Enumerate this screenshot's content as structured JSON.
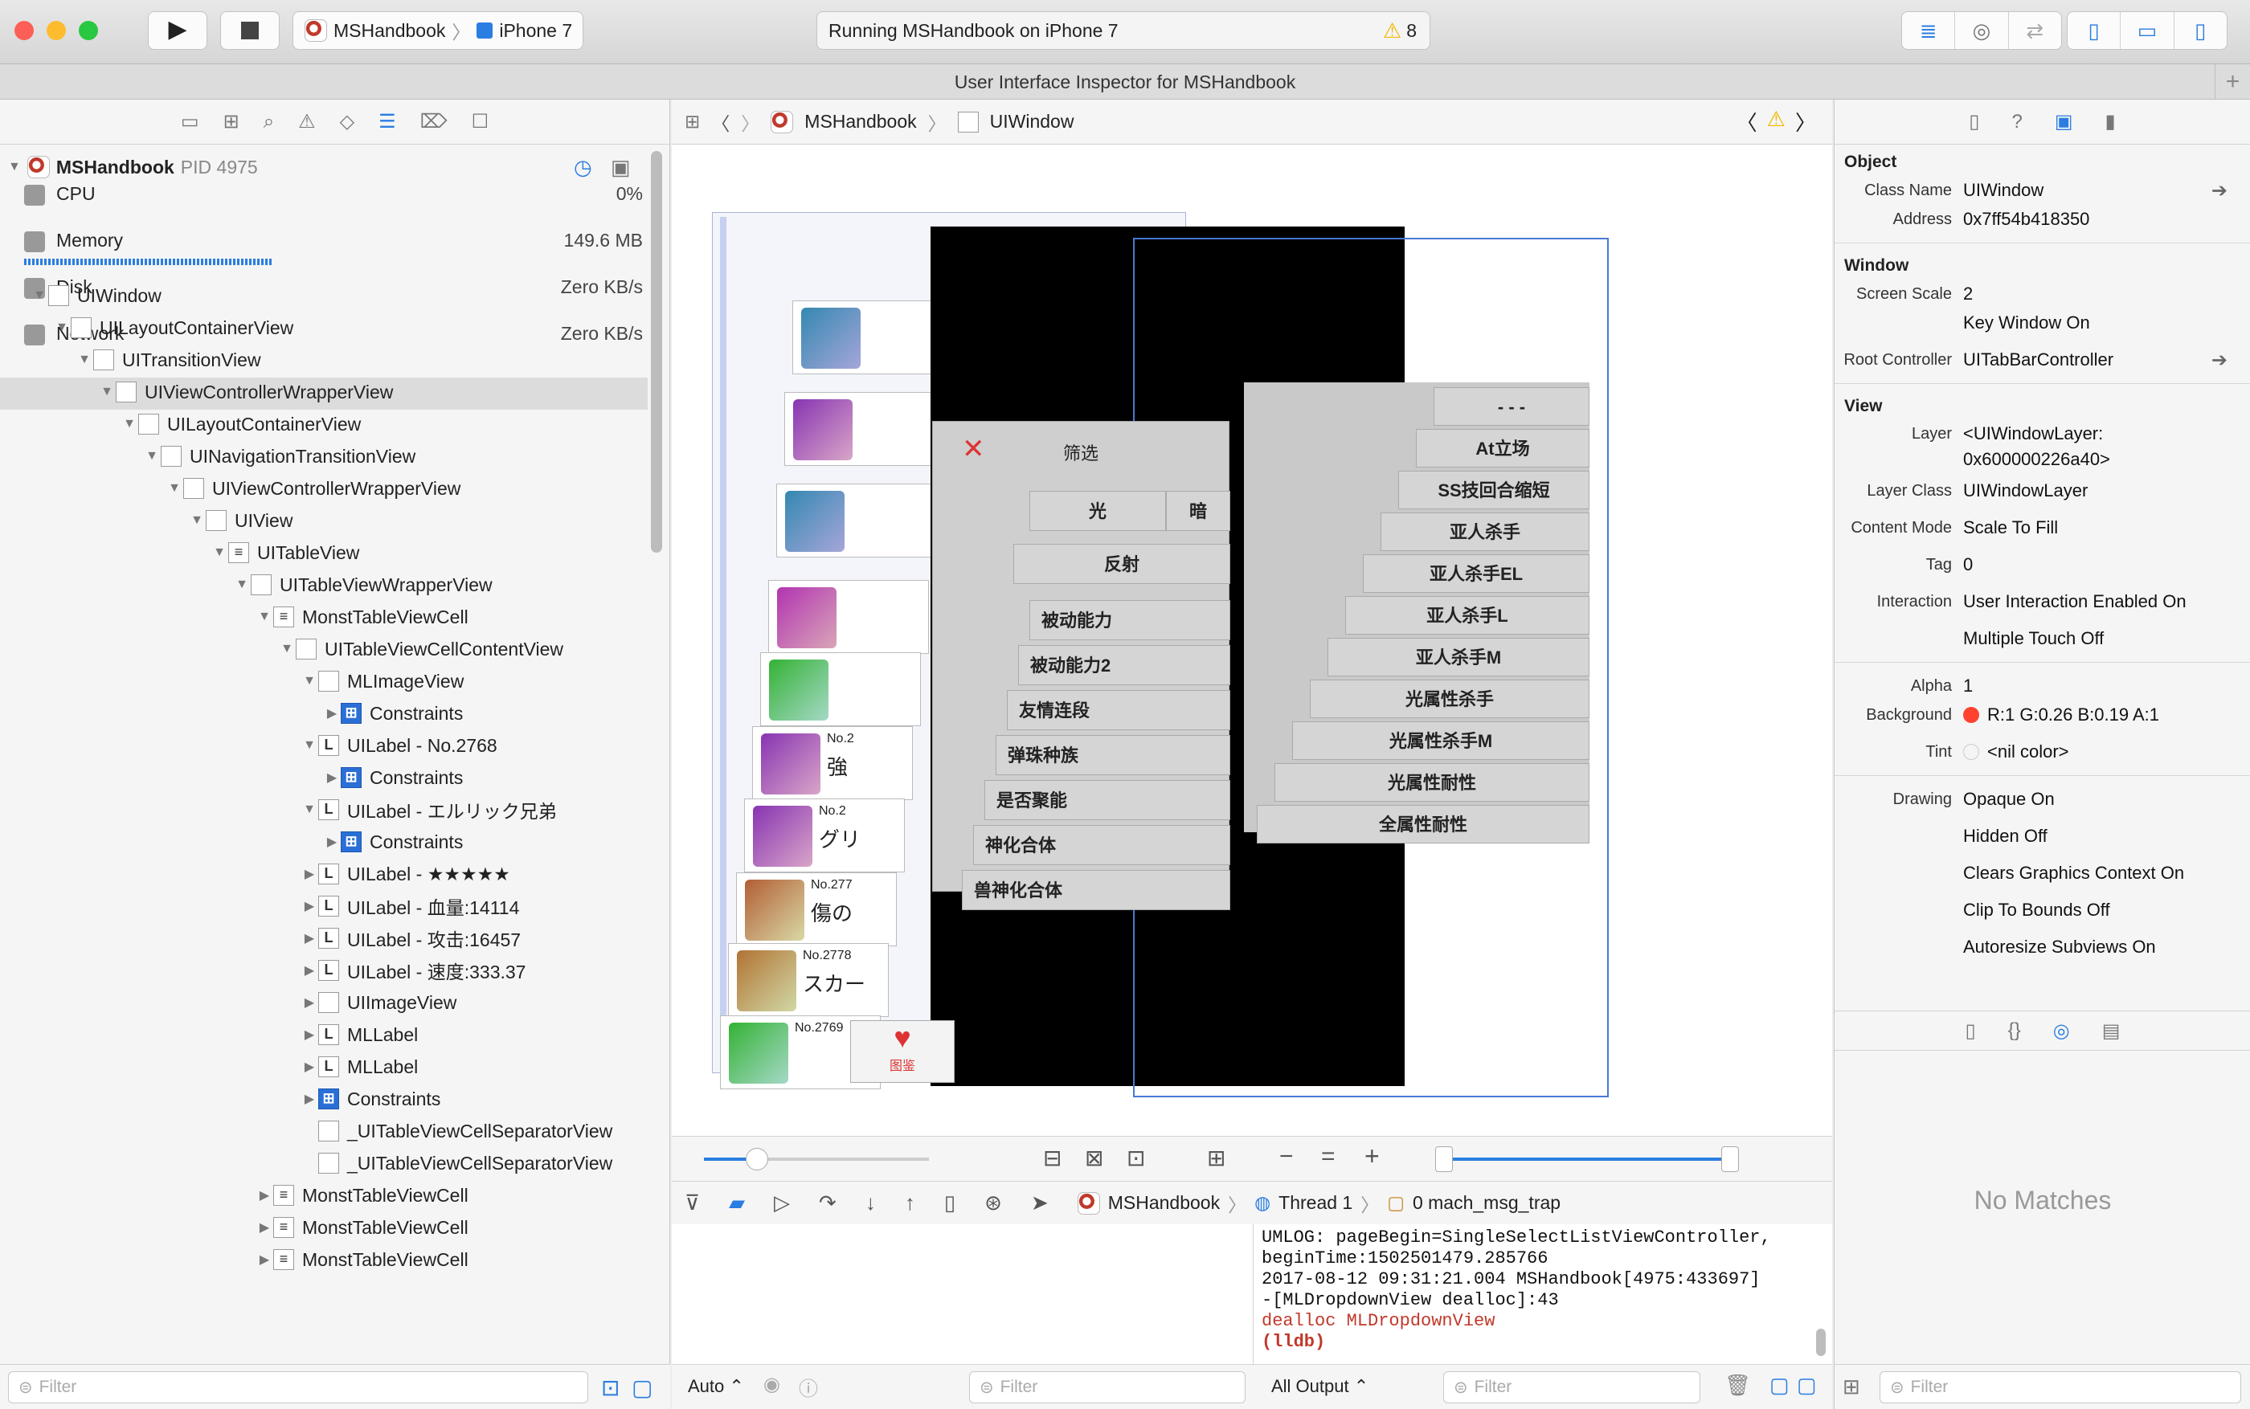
{
  "toolbar": {
    "scheme_app": "MSHandbook",
    "scheme_device": "iPhone 7",
    "status": "Running MSHandbook on iPhone 7",
    "warning_count": "8"
  },
  "tabbar": {
    "title": "User Interface Inspector for MSHandbook"
  },
  "navigator": {
    "process": {
      "name": "MSHandbook",
      "pid": "PID 4975"
    },
    "gauges": [
      {
        "label": "CPU",
        "value": "0%"
      },
      {
        "label": "Memory",
        "value": "149.6 MB"
      },
      {
        "label": "Disk",
        "value": "Zero KB/s"
      },
      {
        "label": "Network",
        "value": "Zero KB/s"
      }
    ],
    "tree": [
      {
        "label": "UIWindow",
        "depth": 0,
        "tri": "▼",
        "icon": "w",
        "selected": true
      },
      {
        "label": "UILayoutContainerView",
        "depth": 1,
        "tri": "▼",
        "icon": "v"
      },
      {
        "label": "UITransitionView",
        "depth": 2,
        "tri": "▼",
        "icon": "v"
      },
      {
        "label": "UIViewControllerWrapperView",
        "depth": 3,
        "tri": "▼",
        "icon": "v"
      },
      {
        "label": "UILayoutContainerView",
        "depth": 4,
        "tri": "▼",
        "icon": "v"
      },
      {
        "label": "UINavigationTransitionView",
        "depth": 5,
        "tri": "▼",
        "icon": "v"
      },
      {
        "label": "UIViewControllerWrapperView",
        "depth": 6,
        "tri": "▼",
        "icon": "v"
      },
      {
        "label": "UIView",
        "depth": 7,
        "tri": "▼",
        "icon": "v"
      },
      {
        "label": "UITableView",
        "depth": 8,
        "tri": "▼",
        "icon": "t"
      },
      {
        "label": "UITableViewWrapperView",
        "depth": 9,
        "tri": "▼",
        "icon": "v"
      },
      {
        "label": "MonstTableViewCell",
        "depth": 10,
        "tri": "▼",
        "icon": "t"
      },
      {
        "label": "UITableViewCellContentView",
        "depth": 11,
        "tri": "▼",
        "icon": "v"
      },
      {
        "label": "MLImageView",
        "depth": 12,
        "tri": "▼",
        "icon": "i"
      },
      {
        "label": "Constraints",
        "depth": 13,
        "tri": "▶",
        "icon": "c"
      },
      {
        "label": "UILabel - No.2768",
        "depth": 12,
        "tri": "▼",
        "icon": "L"
      },
      {
        "label": "Constraints",
        "depth": 13,
        "tri": "▶",
        "icon": "c"
      },
      {
        "label": "UILabel - エルリック兄弟",
        "depth": 12,
        "tri": "▼",
        "icon": "L"
      },
      {
        "label": "Constraints",
        "depth": 13,
        "tri": "▶",
        "icon": "c"
      },
      {
        "label": "UILabel - ★★★★★",
        "depth": 12,
        "tri": "▶",
        "icon": "L"
      },
      {
        "label": "UILabel - 血量:14114",
        "depth": 12,
        "tri": "▶",
        "icon": "L"
      },
      {
        "label": "UILabel - 攻击:16457",
        "depth": 12,
        "tri": "▶",
        "icon": "L"
      },
      {
        "label": "UILabel - 速度:333.37",
        "depth": 12,
        "tri": "▶",
        "icon": "L"
      },
      {
        "label": "UIImageView",
        "depth": 12,
        "tri": "▶",
        "icon": "i"
      },
      {
        "label": "MLLabel",
        "depth": 12,
        "tri": "▶",
        "icon": "L"
      },
      {
        "label": "MLLabel",
        "depth": 12,
        "tri": "▶",
        "icon": "L"
      },
      {
        "label": "Constraints",
        "depth": 12,
        "tri": "▶",
        "icon": "c"
      },
      {
        "label": "_UITableViewCellSeparatorView",
        "depth": 12,
        "tri": "",
        "icon": "v"
      },
      {
        "label": "_UITableViewCellSeparatorView",
        "depth": 12,
        "tri": "",
        "icon": "v"
      },
      {
        "label": "MonstTableViewCell",
        "depth": 10,
        "tri": "▶",
        "icon": "t"
      },
      {
        "label": "MonstTableViewCell",
        "depth": 10,
        "tri": "▶",
        "icon": "t"
      },
      {
        "label": "MonstTableViewCell",
        "depth": 10,
        "tri": "▶",
        "icon": "t"
      }
    ],
    "filter_placeholder": "Filter"
  },
  "editor": {
    "breadcrumb": {
      "app": "MSHandbook",
      "item": "UIWindow"
    },
    "filter_popup": {
      "title": "筛选",
      "row1": "光",
      "row1b": "暗",
      "reflect": "反射",
      "items": [
        "被动能力",
        "被动能力2",
        "友情连段",
        "弹珠种族",
        "是否聚能",
        "神化合体",
        "兽神化合体"
      ]
    },
    "list_popup": {
      "items": [
        "- - -",
        "At立场",
        "SS技回合缩短",
        "亚人杀手",
        "亚人杀手EL",
        "亚人杀手L",
        "亚人杀手M",
        "光属性杀手",
        "光属性杀手M",
        "光属性耐性",
        "全属性耐性"
      ]
    },
    "cells": [
      {
        "no": "No.2",
        "name": "強"
      },
      {
        "no": "No.2",
        "name": "グリ"
      },
      {
        "no": "No.277",
        "name": "傷の"
      },
      {
        "no": "No.2778",
        "name": "スカー"
      },
      {
        "no": "No.2769",
        "name": ""
      }
    ],
    "tab_label": "图鉴",
    "debug_bar": {
      "app": "MSHandbook",
      "thread": "Thread 1",
      "frame": "0 mach_msg_trap"
    },
    "auto_label": "Auto",
    "console_lines": [
      "UMLOG: pageBegin=SingleSelectListViewController,",
      "beginTime:1502501479.285766",
      "2017-08-12 09:31:21.004 MSHandbook[4975:433697]",
      "-[MLDropdownView dealloc]:43",
      "dealloc MLDropdownView"
    ],
    "prompt": "(lldb)",
    "all_output": "All Output",
    "filter_placeholder": "Filter"
  },
  "inspector": {
    "object": {
      "title": "Object",
      "class_name_label": "Class Name",
      "class_name": "UIWindow",
      "address_label": "Address",
      "address": "0x7ff54b418350"
    },
    "window": {
      "title": "Window",
      "screen_scale_label": "Screen Scale",
      "screen_scale": "2",
      "key_window": "Key Window On",
      "root_label": "Root Controller",
      "root": "UITabBarController"
    },
    "view": {
      "title": "View",
      "layer_label": "Layer",
      "layer": "<UIWindowLayer:",
      "layer2": "0x600000226a40>",
      "layer_class_label": "Layer Class",
      "layer_class": "UIWindowLayer",
      "content_mode_label": "Content Mode",
      "content_mode": "Scale To Fill",
      "tag_label": "Tag",
      "tag": "0",
      "interaction_label": "Interaction",
      "interaction": "User Interaction Enabled On",
      "multi_touch": "Multiple Touch Off",
      "alpha_label": "Alpha",
      "alpha": "1",
      "background_label": "Background",
      "background": "R:1 G:0.26 B:0.19 A:1",
      "tint_label": "Tint",
      "tint": "<nil color>",
      "drawing_label": "Drawing",
      "drawing": "Opaque On",
      "hidden": "Hidden Off",
      "clears": "Clears Graphics Context On",
      "clip": "Clip To Bounds Off",
      "autoresize": "Autoresize Subviews On"
    },
    "no_matches": "No Matches",
    "filter_placeholder": "Filter"
  },
  "colors": {
    "accent": "#2a7de1",
    "bg_swatch": "#ff4230",
    "warning": "#f5b800"
  }
}
